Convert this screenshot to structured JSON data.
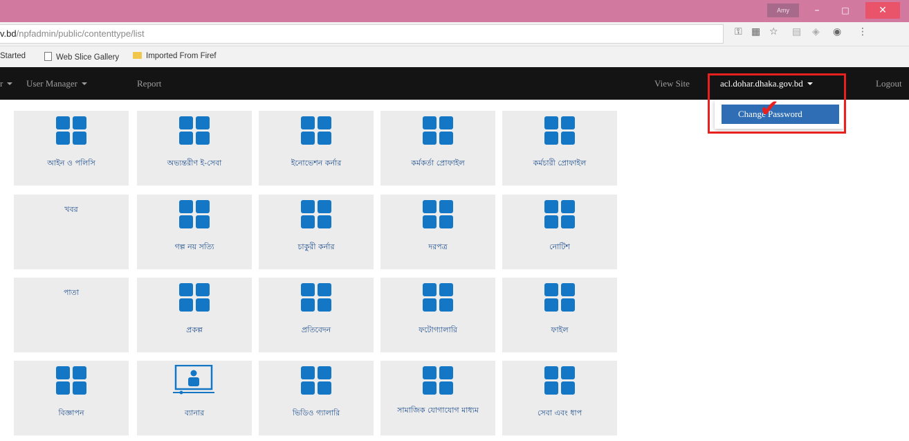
{
  "browser": {
    "user_chip": "Amy",
    "url_host": "v.bd",
    "url_path": "/npfadmin/public/contenttype/list",
    "window_controls": {
      "minimize": "–",
      "maximize": "□",
      "close": "✕"
    },
    "omnibox_icons": [
      "key-icon",
      "translate-icon",
      "star-icon",
      "extension-icon",
      "extension-icon",
      "extension-icon",
      "menu-icon"
    ]
  },
  "bookmarks": [
    {
      "label": "Started",
      "icon": "none"
    },
    {
      "label": "Web Slice Gallery",
      "icon": "page-icon"
    },
    {
      "label": "Imported From Firef",
      "icon": "folder-icon"
    }
  ],
  "navbar": {
    "partial_left": "r",
    "user_manager": "User Manager",
    "report": "Report",
    "view_site": "View Site",
    "user_account": "acl.dohar.dhaka.gov.bd",
    "logout": "Logout"
  },
  "dropdown": {
    "change_password": "Change Password"
  },
  "colors": {
    "titlebar": "#d2799f",
    "navbar": "#141414",
    "highlight": "#e8201e",
    "dropdown_item": "#2f6eb5",
    "tile_bg": "#ececec",
    "tile_icon": "#1377c5",
    "tile_label": "#1f4f8c"
  },
  "tiles": [
    {
      "label": "আইন ও পলিসি",
      "icon": "grid-icon"
    },
    {
      "label": "অভ্যন্তরীণ ই-সেবা",
      "icon": "grid-icon"
    },
    {
      "label": "ইনোভেশন কর্নার",
      "icon": "grid-icon"
    },
    {
      "label": "কর্মকর্তা প্রোফাইল",
      "icon": "grid-icon"
    },
    {
      "label": "কর্মচারী প্রোফাইল",
      "icon": "grid-icon"
    },
    {
      "label": "খবর",
      "icon": "none"
    },
    {
      "label": "গল্প নয় সত্যি",
      "icon": "grid-icon"
    },
    {
      "label": "চাকুরী কর্নার",
      "icon": "grid-icon"
    },
    {
      "label": "দরপত্র",
      "icon": "grid-icon"
    },
    {
      "label": "নোটিশ",
      "icon": "grid-icon"
    },
    {
      "label": "পাতা",
      "icon": "none"
    },
    {
      "label": "প্রকল্প",
      "icon": "grid-icon"
    },
    {
      "label": "প্রতিবেদন",
      "icon": "grid-icon"
    },
    {
      "label": "ফটোগ্যালারি",
      "icon": "grid-icon"
    },
    {
      "label": "ফাইল",
      "icon": "grid-icon"
    },
    {
      "label": "বিজ্ঞাপন",
      "icon": "grid-icon"
    },
    {
      "label": "ব্যানার",
      "icon": "banner-icon"
    },
    {
      "label": "ভিডিও গ্যালারি",
      "icon": "grid-icon"
    },
    {
      "label": "সামাজিক যোগাযোগ মাধ্যম",
      "icon": "grid-icon"
    },
    {
      "label": "সেবা এবং ধাপ",
      "icon": "grid-icon"
    }
  ]
}
